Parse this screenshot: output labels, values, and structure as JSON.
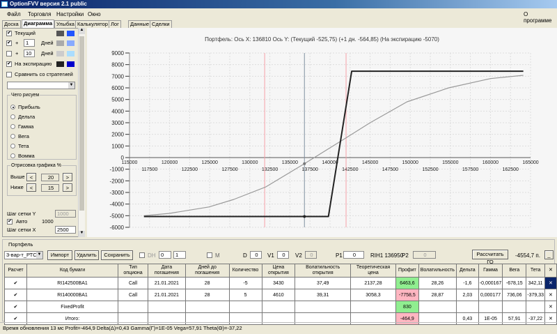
{
  "window": {
    "title": "OptionFVV версия 2.1 public"
  },
  "menu": {
    "items": [
      "Файл",
      "Торговля",
      "Настройки",
      "Окно"
    ],
    "about": "О программе"
  },
  "tabs": [
    "Доска",
    "Диаграмма",
    "Улыбка",
    "Калькулятор",
    "Лог",
    "Данные",
    "Сделки"
  ],
  "active_tab": "Диаграмма",
  "left": {
    "current": {
      "label": "Текущий",
      "checked": true,
      "colors": [
        "#555555",
        "#2255ff"
      ]
    },
    "plus1": {
      "plus": "+",
      "days": "1",
      "unit": "Дней",
      "checked": true,
      "colors": [
        "#aaaaaa",
        "#88aaff"
      ]
    },
    "plus10": {
      "plus": "+",
      "days": "10",
      "unit": "Дней",
      "checked": false,
      "colors": [
        "#cccccc",
        "#aaddff"
      ]
    },
    "expiry": {
      "label": "На экспирацию",
      "checked": true,
      "colors": [
        "#222222",
        "#0000cc"
      ]
    },
    "compare": {
      "label": "Сравнить со стратегией",
      "checked": false
    },
    "draw_group": "Чего рисуем",
    "radios": [
      "Прибыль",
      "Дельта",
      "Гамма",
      "Вега",
      "Тета",
      "Вомма"
    ],
    "radio_selected": "Прибыль",
    "range_group": "Отрисовка графика %",
    "above_label": "Выше",
    "above": "20",
    "below_label": "Ниже",
    "below": "15",
    "prev": "<",
    "next": ">",
    "grid_y_label": "Шаг сетки Y",
    "grid_y": "1000",
    "auto_label": "Авто",
    "auto_checked": true,
    "auto_value": "1000",
    "grid_x_label": "Шаг сетки X",
    "grid_x": "2500"
  },
  "chart_data": {
    "type": "line",
    "title": "Портфель: Ось X:  136810 Ось Y:   (Текущий  -525,75)   (+1 дн.  -564,85)   (На экспирацию  -5070)",
    "xlim": [
      115000,
      165000
    ],
    "ylim": [
      -6000,
      9000
    ],
    "grid": true,
    "xticks_top": [
      115000,
      120000,
      125000,
      130000,
      135000,
      140000,
      145000,
      150000,
      155000,
      160000,
      165000
    ],
    "xticks_bottom": [
      117500,
      122500,
      127500,
      132500,
      137500,
      142500,
      147500,
      152500,
      157500,
      162500
    ],
    "yticks": [
      9000,
      8000,
      7000,
      6000,
      5000,
      4000,
      3000,
      2000,
      1000,
      0,
      -1000,
      -2000,
      -3000,
      -4000,
      -5000,
      -6000
    ],
    "current_x": 136810,
    "range_lines": [
      131850,
      142000
    ],
    "series": [
      {
        "key": "current",
        "color": "#999999",
        "x": [
          116800,
          120000,
          124900,
          128000,
          132000,
          136810,
          141400,
          145000,
          149600,
          154800,
          160000,
          164100
        ],
        "y": [
          -5000,
          -4800,
          -4250,
          -3600,
          -2520,
          -525,
          1440,
          3000,
          4800,
          6000,
          6800,
          7080
        ]
      },
      {
        "key": "expiry",
        "color": "#222222",
        "x": [
          116800,
          139800,
          142700,
          164100
        ],
        "y": [
          -5070,
          -5070,
          7430,
          7430
        ]
      }
    ]
  },
  "portfolio": {
    "group": "Портфель",
    "select": "3-вар-т_РТС",
    "import": "Импорт",
    "delete": "Удалить",
    "save": "Сохранить",
    "dh": "DH",
    "spin1": "0",
    "spin2": "1",
    "m": "M",
    "d_label": "D",
    "d": "0",
    "v1_label": "V1",
    "v1": "0",
    "v2_label": "V2",
    "v2": "0",
    "p1_label": "P1",
    "p1": "0",
    "ticker": "RIH1 136950",
    "p2_label": "P2",
    "p2": "0",
    "calc_go": "Рассчитать ГО",
    "go_value": "-4554,7 п.",
    "min": "_",
    "columns": [
      "Расчет",
      "Код бумаги",
      "Тип опциона",
      "Дата погашения",
      "Дней до погашения",
      "Количество",
      "Цена открытия",
      "Волатильность открытия",
      "Теоретическая цена",
      "Профит",
      "Волатильность",
      "Дельта",
      "Гамма",
      "Вега",
      "Тета",
      "✕"
    ],
    "rows": [
      [
        "✔",
        "RI142500BA1",
        "Call",
        "21.01.2021",
        "28",
        "-5",
        "3430",
        "37,49",
        "2137,28",
        "6463,6",
        "28,26",
        "-1,6",
        "-0,000167",
        "-678,15",
        "342,11",
        "✕"
      ],
      [
        "✔",
        "RI140000BA1",
        "Call",
        "21.01.2021",
        "28",
        "5",
        "4610",
        "39,31",
        "3058,3",
        "-7758,5",
        "28,87",
        "2,03",
        "0,000177",
        "736,06",
        "-379,33",
        "✕"
      ],
      [
        "✔",
        "FixedProfit",
        "",
        "",
        "",
        "",
        "",
        "",
        "",
        "830",
        "",
        "",
        "",
        "",
        "",
        "✕"
      ],
      [
        "✔",
        "Итого:",
        "",
        "",
        "",
        "",
        "",
        "",
        "",
        "-464,9",
        "",
        "0,43",
        "1E-05",
        "57,91",
        "-37,22",
        "✕"
      ]
    ],
    "profit_colors": {
      "positive": "#90ee90",
      "negative": "#ffb6c1"
    }
  },
  "status": "Время обновления 13 мс  Profit=-464,9 Delta(Δ)=0,43 Gamma(Γ)=1E-05 Vega=57,91 Theta(Θ)=-37,22"
}
